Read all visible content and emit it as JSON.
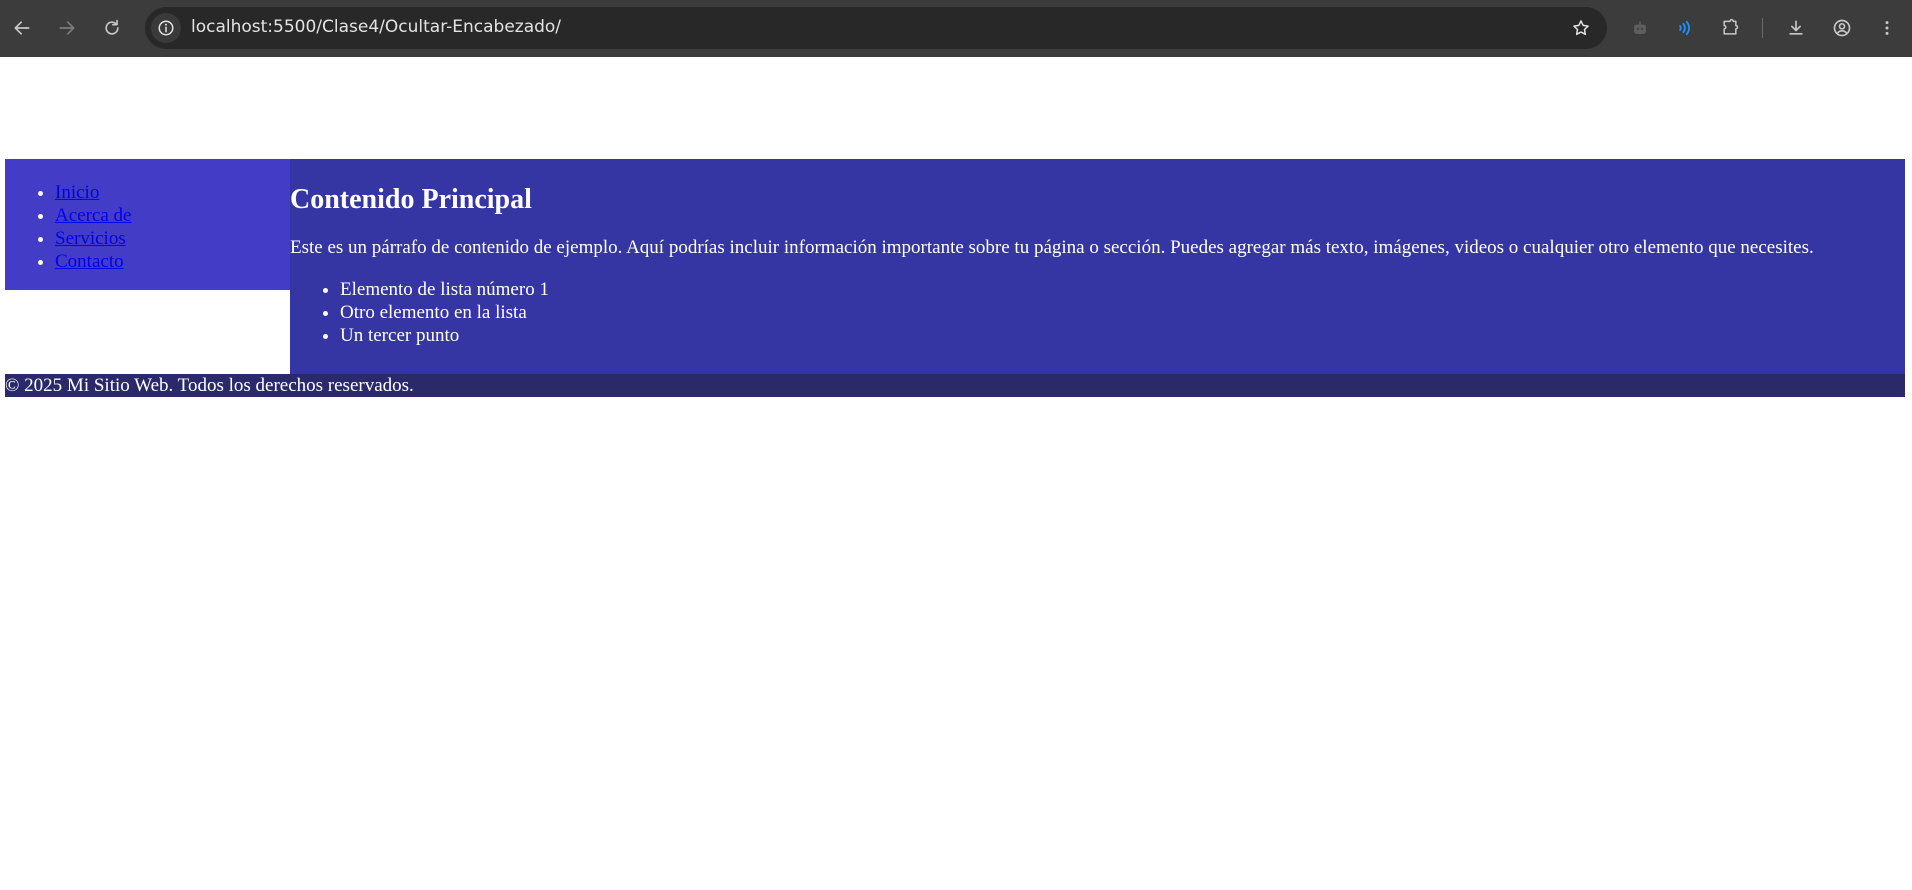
{
  "browser": {
    "url": "localhost:5500/Clase4/Ocultar-Encabezado/",
    "icons": {
      "back": "arrow-left-icon",
      "forward": "arrow-right-icon",
      "reload": "reload-icon",
      "site_info": "info-icon",
      "bookmark": "star-icon",
      "gemini": "robot-icon",
      "read_aloud": "audio-waves-icon",
      "extensions": "puzzle-icon",
      "downloads": "download-icon",
      "profile": "account-circle-icon",
      "menu": "kebab-menu-icon"
    },
    "colors": {
      "toolbar_bg": "#3c3c3c",
      "omnibox_bg": "#282828",
      "accent_blue": "#1e90ff"
    }
  },
  "page": {
    "nav": {
      "items": [
        {
          "label": "Inicio"
        },
        {
          "label": "Acerca de"
        },
        {
          "label": "Servicios"
        },
        {
          "label": "Contacto"
        }
      ]
    },
    "main": {
      "title": "Contenido Principal",
      "paragraph": "Este es un párrafo de contenido de ejemplo. Aquí podrías incluir información importante sobre tu página o sección. Puedes agregar más texto, imágenes, videos o cualquier otro elemento que necesites.",
      "list": [
        "Elemento de lista número 1",
        "Otro elemento en la lista",
        "Un tercer punto"
      ]
    },
    "footer": {
      "text": "© 2025 Mi Sitio Web. Todos los derechos reservados."
    },
    "colors": {
      "sidebar_bg": "#433cc6",
      "main_bg": "#3535a3",
      "footer_bg": "#2a2a6b",
      "link": "#0000ee"
    }
  }
}
